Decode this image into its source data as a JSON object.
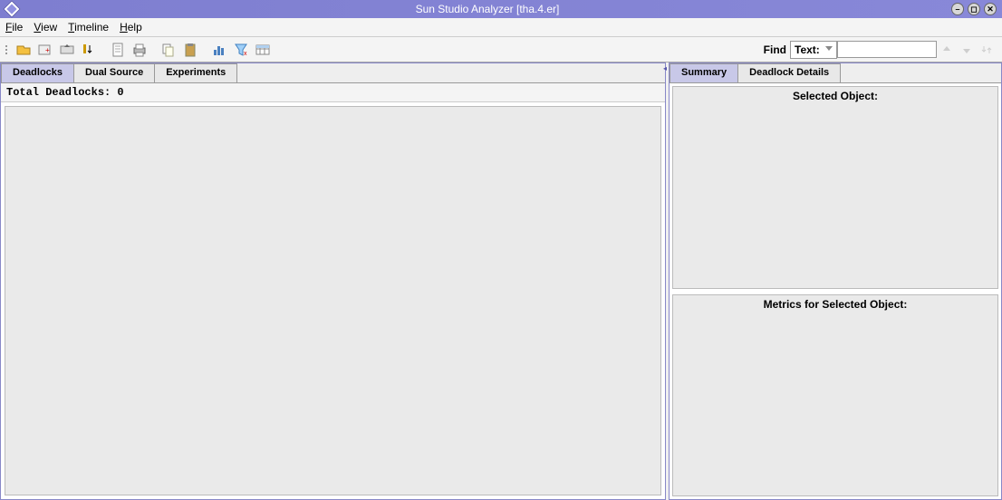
{
  "window": {
    "title": "Sun Studio Analyzer [tha.4.er]"
  },
  "menu": {
    "file": "File",
    "view": "View",
    "timeline": "Timeline",
    "help": "Help"
  },
  "toolbar": {
    "find_label": "Find",
    "find_type_label": "Text:",
    "find_value": ""
  },
  "left": {
    "tabs": {
      "deadlocks": "Deadlocks",
      "dualsource": "Dual Source",
      "experiments": "Experiments"
    },
    "total_deadlocks_label": "Total Deadlocks: 0"
  },
  "right": {
    "tabs": {
      "summary": "Summary",
      "deadlock_details": "Deadlock Details"
    },
    "selected_object_label": "Selected Object:",
    "metrics_label": "Metrics for Selected Object:"
  }
}
